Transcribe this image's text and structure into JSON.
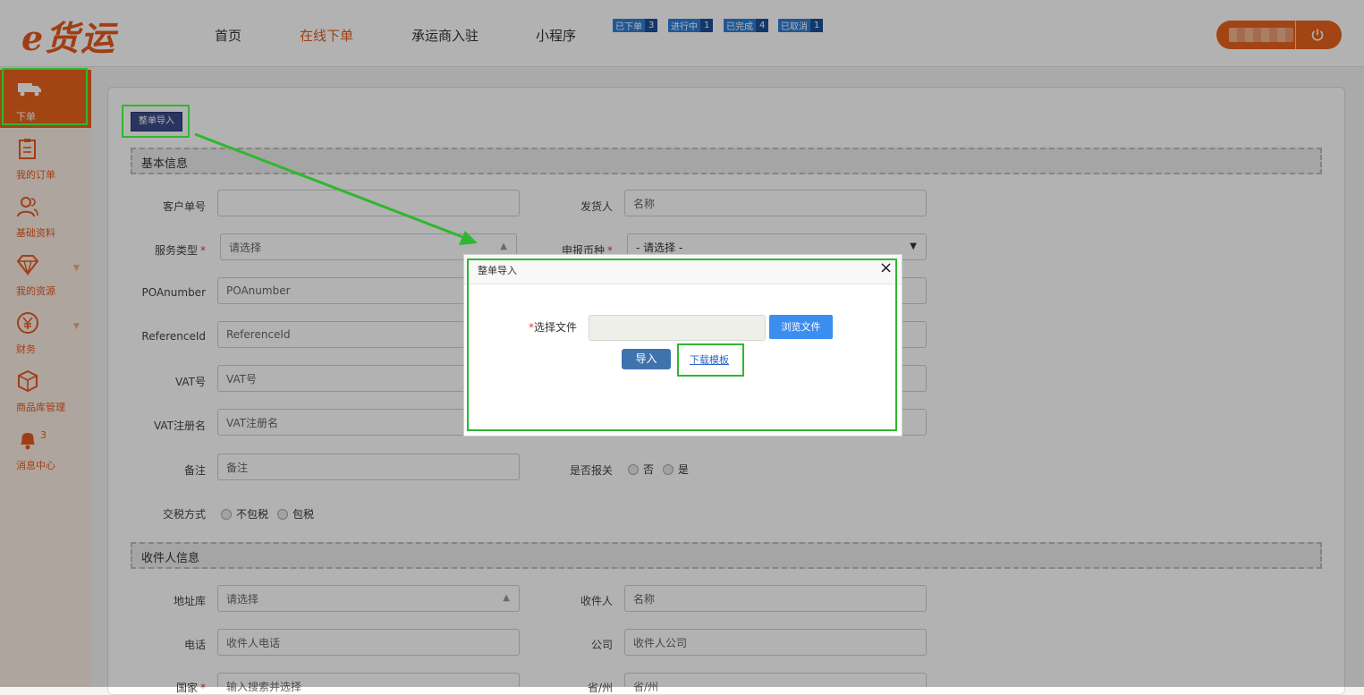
{
  "header": {
    "logo": "e货运",
    "nav": [
      "首页",
      "在线下单",
      "承运商入驻",
      "小程序"
    ],
    "active_nav": "在线下单",
    "badges": [
      {
        "label": "已下单",
        "count": "3"
      },
      {
        "label": "进行中",
        "count": "1"
      },
      {
        "label": "已完成",
        "count": "4"
      },
      {
        "label": "已取消",
        "count": "1"
      }
    ],
    "logout_icon": "power-icon"
  },
  "sidebar": {
    "items": [
      {
        "label": "下单",
        "icon": "truck-icon"
      },
      {
        "label": "我的订单",
        "icon": "clipboard-icon"
      },
      {
        "label": "基础资料",
        "icon": "users-icon"
      },
      {
        "label": "我的资源",
        "icon": "diamond-icon"
      },
      {
        "label": "财务",
        "icon": "yen-icon"
      },
      {
        "label": "商品库管理",
        "icon": "box-icon"
      },
      {
        "label": "消息中心",
        "icon": "bell-icon",
        "count": "3"
      }
    ]
  },
  "main": {
    "import_button": "整单导入",
    "sections": {
      "basic": "基本信息",
      "receiver": "收件人信息"
    },
    "fields": {
      "customer_no": {
        "label": "客户单号",
        "value": ""
      },
      "shipper": {
        "label": "发货人",
        "placeholder": "名称"
      },
      "service_type": {
        "label": "服务类型",
        "value": "请选择"
      },
      "currency": {
        "label": "申报币种",
        "value": "- 请选择 -"
      },
      "poa": {
        "label": "POAnumber",
        "placeholder": "POAnumber"
      },
      "reference": {
        "label": "ReferenceId",
        "placeholder": "ReferenceId"
      },
      "vat": {
        "label": "VAT号",
        "placeholder": "VAT号"
      },
      "vat_name": {
        "label": "VAT注册名",
        "placeholder": "VAT注册名"
      },
      "remark": {
        "label": "备注",
        "placeholder": "备注"
      },
      "customs": {
        "label": "是否报关",
        "options": [
          "否",
          "是"
        ]
      },
      "tax": {
        "label": "交税方式",
        "options": [
          "不包税",
          "包税"
        ]
      },
      "address_book": {
        "label": "地址库",
        "value": "请选择"
      },
      "receiver": {
        "label": "收件人",
        "placeholder": "名称"
      },
      "phone": {
        "label": "电话",
        "placeholder": "收件人电话"
      },
      "company": {
        "label": "公司",
        "placeholder": "收件人公司"
      },
      "country": {
        "label": "国家",
        "placeholder": "输入搜索并选择"
      },
      "state": {
        "label": "省/州",
        "placeholder": "省/州"
      }
    }
  },
  "modal": {
    "title": "整单导入",
    "close": "×",
    "file_label": "选择文件",
    "required_mark": "*",
    "browse_button": "浏览文件",
    "import_button": "导入",
    "download_link": "下载模板"
  },
  "colors": {
    "accent": "#e8621e",
    "highlight": "#2eb82e",
    "primary_btn": "#3b8ef0"
  }
}
